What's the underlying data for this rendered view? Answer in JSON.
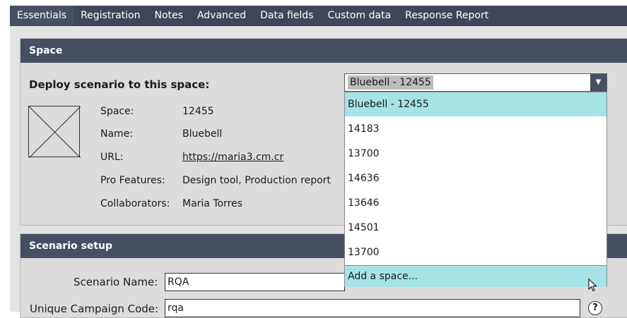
{
  "tabs": [
    {
      "label": "Essentials",
      "active": true
    },
    {
      "label": "Registration"
    },
    {
      "label": "Notes"
    },
    {
      "label": "Advanced"
    },
    {
      "label": "Data fields"
    },
    {
      "label": "Custom data"
    },
    {
      "label": "Response Report"
    }
  ],
  "space_panel": {
    "title": "Space",
    "deploy_label": "Deploy scenario to this space:",
    "select_value": "Bluebell - 12455",
    "info": {
      "space_key": "Space:",
      "space_val": "12455",
      "name_key": "Name:",
      "name_val": "Bluebell",
      "url_key": "URL:",
      "url_val": "https://maria3.cm.cr",
      "pro_key": "Pro Features:",
      "pro_val": "Design tool, Production report",
      "collab_key": "Collaborators:",
      "collab_val": "Maria Torres"
    }
  },
  "dropdown": {
    "options": [
      "Bluebell - 12455",
      "14183",
      "13700",
      "14636",
      "13646",
      "14501",
      "13700",
      "Add a space..."
    ],
    "highlighted_index": 0,
    "hover_index": 7
  },
  "setup_panel": {
    "title": "Scenario setup",
    "scenario_name_label": "Scenario Name:",
    "scenario_name_value": "RQA",
    "campaign_code_label": "Unique Campaign Code:",
    "campaign_code_value": "rqa",
    "help_glyph": "?"
  },
  "colors": {
    "header_bg": "#474f62",
    "tab_strip_bg": "#3f4658",
    "highlight": "#a6e3e6",
    "panel_bg": "#dcdcdc"
  },
  "icons": {
    "placeholder": "image-placeholder-icon",
    "select_arrow": "chevron-down-icon",
    "help": "help-icon",
    "cursor": "mouse-pointer-icon"
  }
}
